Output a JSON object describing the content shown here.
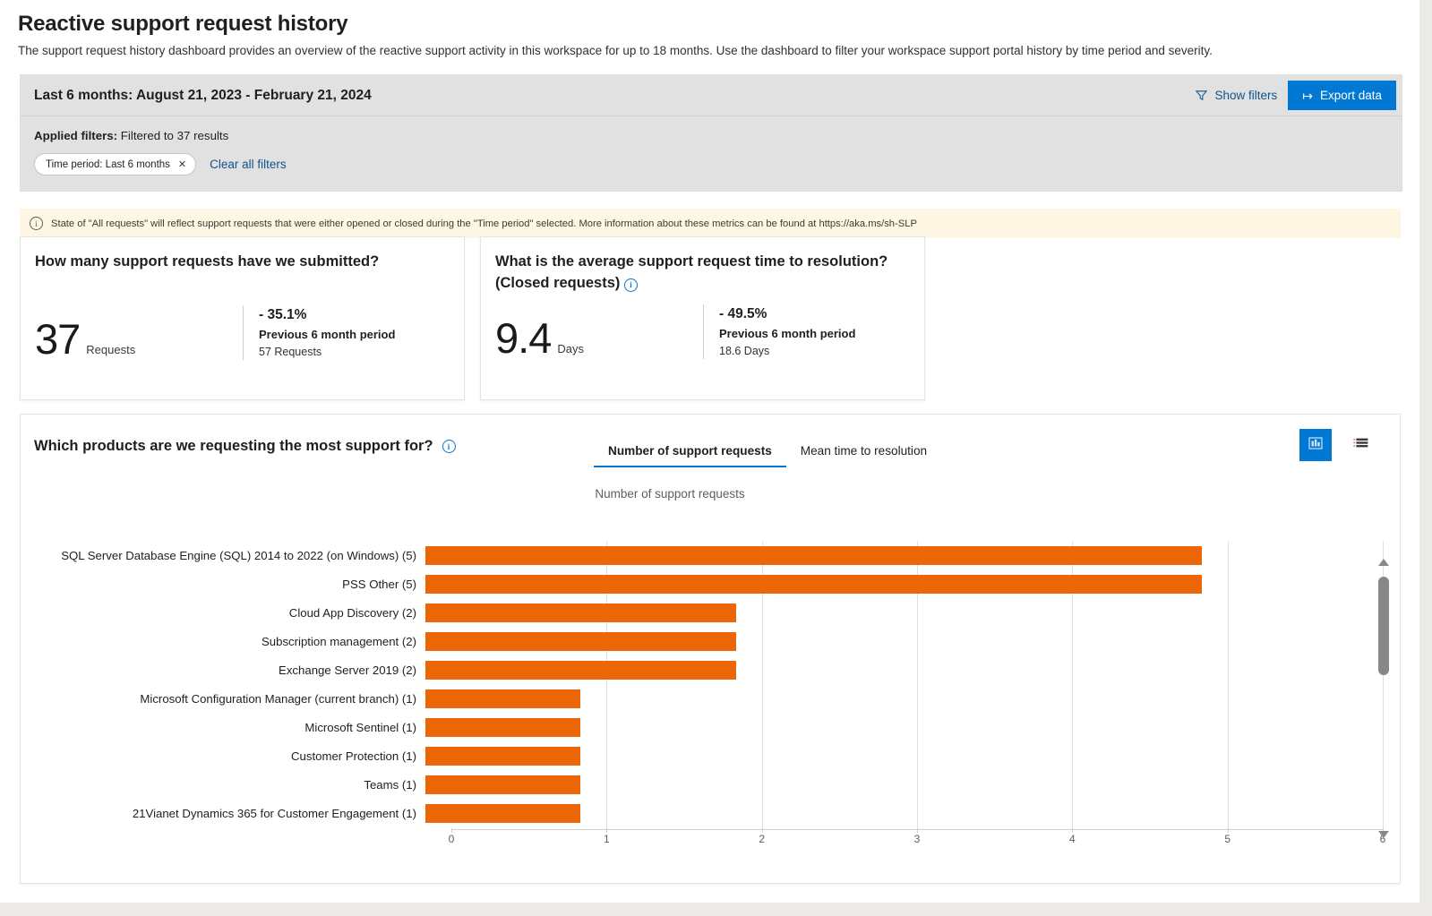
{
  "page": {
    "title": "Reactive support request history",
    "description": "The support request history dashboard provides an overview of the reactive support activity in this workspace for up to 18 months. Use the dashboard to filter your workspace support portal history by time period and severity."
  },
  "filter_panel": {
    "range_label": "Last 6 months: August 21, 2023 - February 21, 2024",
    "show_filters_label": "Show filters",
    "export_label": "Export data",
    "applied_filters_label": "Applied filters:",
    "applied_filters_value": "Filtered to 37 results",
    "chips": [
      {
        "label": "Time period: Last 6 months",
        "close": "✕"
      }
    ],
    "clear_all_label": "Clear all filters"
  },
  "info_banner": {
    "text": "State of \"All requests\" will reflect support requests that were either opened or closed during the \"Time period\" selected. More information about these metrics can be found at https://aka.ms/sh-SLP"
  },
  "kpis": [
    {
      "title": "How many support requests have we submitted?",
      "value": "37",
      "unit": "Requests",
      "delta": "- 35.1%",
      "previous_label": "Previous 6 month period",
      "previous_value": "57 Requests"
    },
    {
      "title": "What is the average support request time to resolution?",
      "title_suffix": "(Closed requests)",
      "value": "9.4",
      "unit": "Days",
      "delta": "- 49.5%",
      "previous_label": "Previous 6 month period",
      "previous_value": "18.6 Days"
    }
  ],
  "chart_card": {
    "question": "Which products are we requesting the most support for?",
    "tabs": [
      {
        "label": "Number of support requests",
        "active": true
      },
      {
        "label": "Mean time to resolution",
        "active": false
      }
    ],
    "view_toggle": [
      {
        "name": "chart-view",
        "selected": true
      },
      {
        "name": "list-view",
        "selected": false
      }
    ]
  },
  "chart_data": {
    "type": "bar",
    "orientation": "horizontal",
    "title": "Number of support requests",
    "xlabel": "",
    "ylabel": "",
    "xlim": [
      0,
      6
    ],
    "xticks": [
      0,
      1,
      2,
      3,
      4,
      5,
      6
    ],
    "grid": true,
    "legend": "none",
    "bar_color": "#ec6608",
    "categories": [
      "SQL Server  Database Engine (SQL)  2014 to 2022 (on Windows) (5)",
      "PSS Other (5)",
      "Cloud App Discovery (2)",
      "Subscription management (2)",
      "Exchange Server 2019 (2)",
      "Microsoft Configuration Manager (current branch) (1)",
      "Microsoft Sentinel (1)",
      "Customer Protection (1)",
      "Teams (1)",
      "21Vianet Dynamics 365 for Customer Engagement (1)"
    ],
    "values": [
      5,
      5,
      2,
      2,
      2,
      1,
      1,
      1,
      1,
      1
    ]
  },
  "colors": {
    "accent_blue": "#0078d4",
    "link_blue": "#0f548c",
    "bar_orange": "#ec6608",
    "banner_yellow": "#fdf6e3",
    "panel_grey": "#e1e1e1"
  }
}
